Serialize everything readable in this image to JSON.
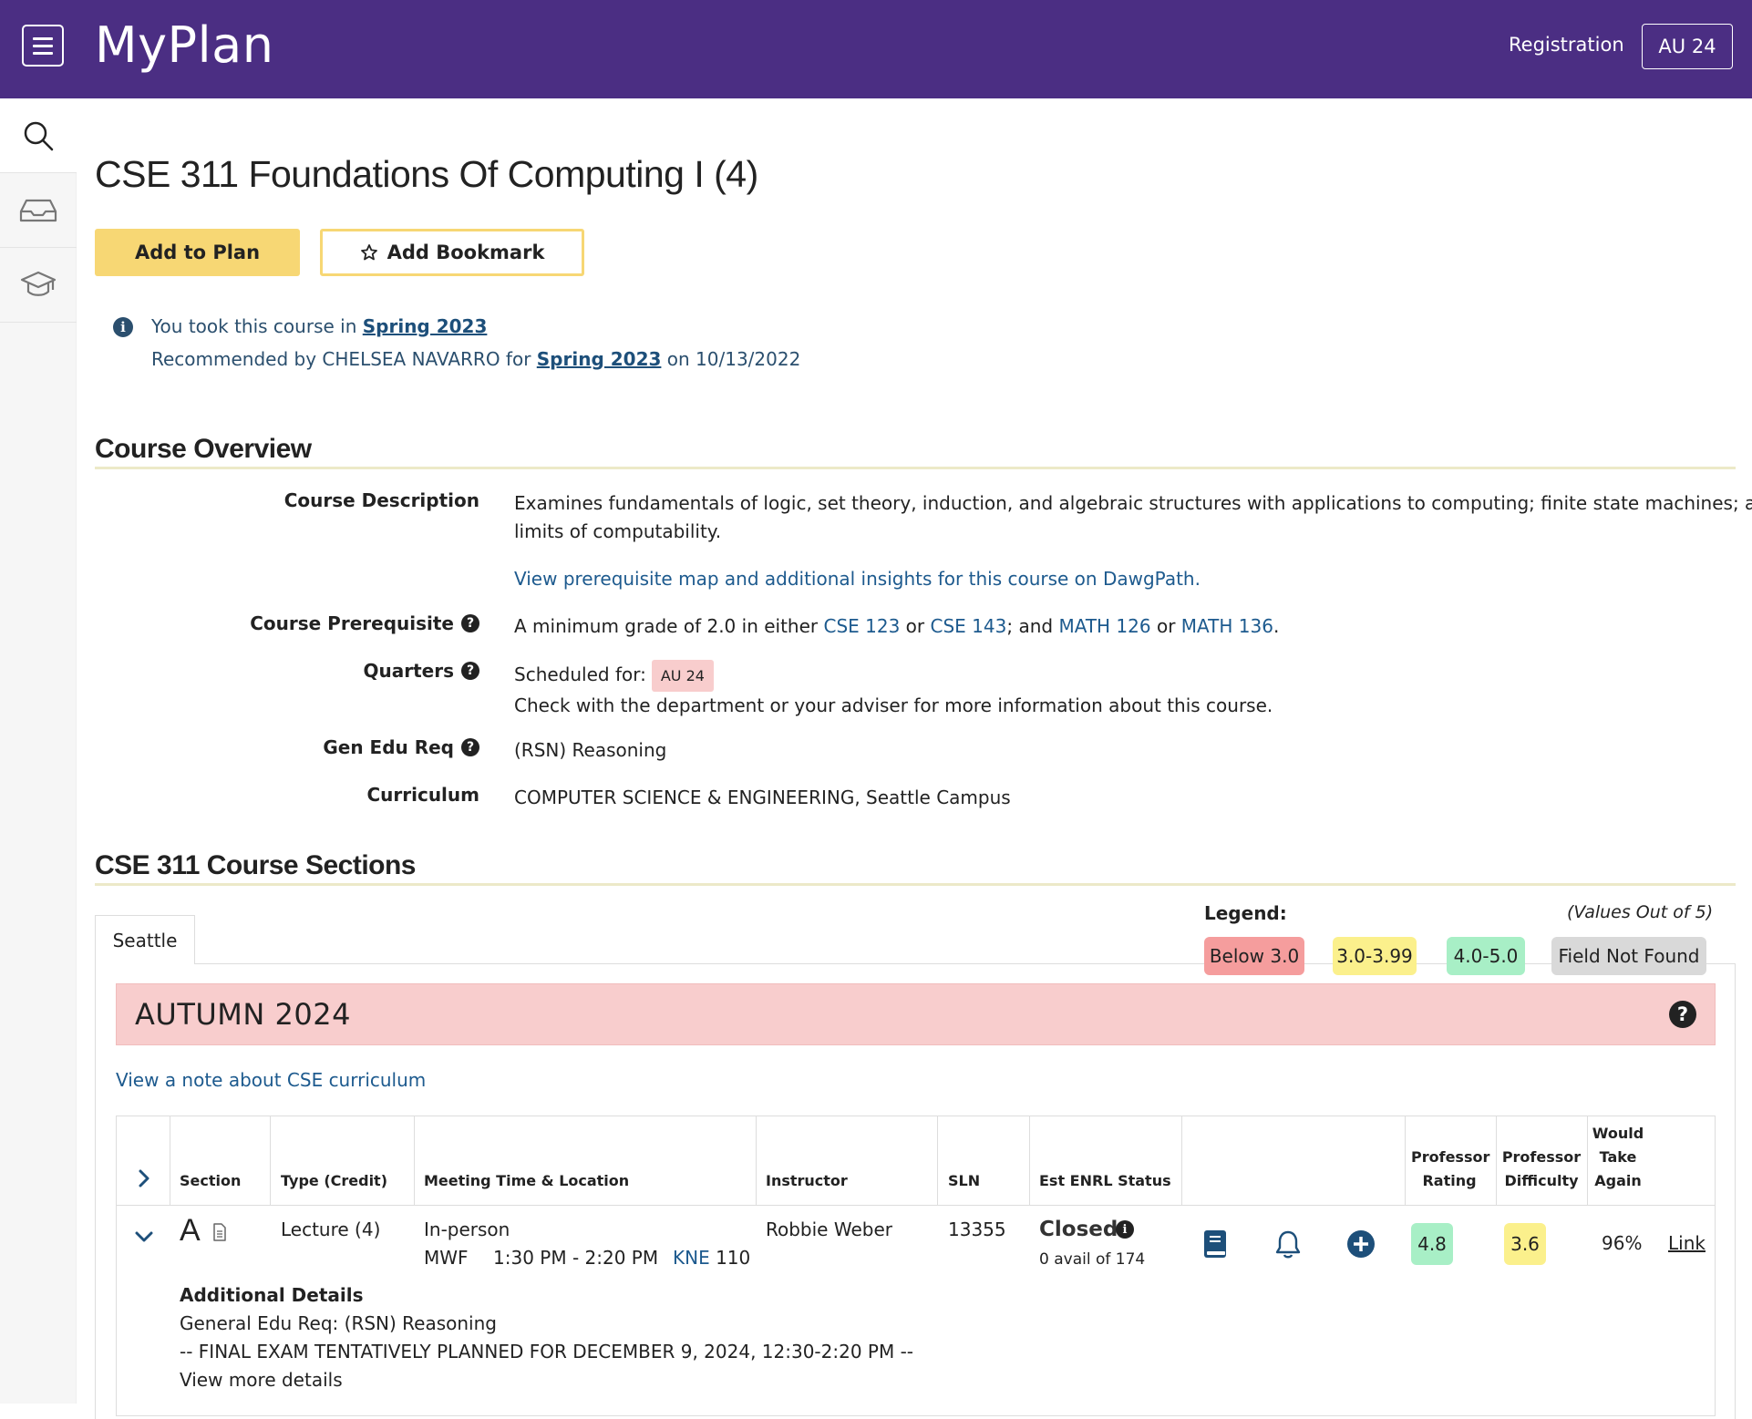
{
  "header": {
    "brand": "MyPlan",
    "registration_label": "Registration",
    "term_button": "AU 24"
  },
  "course": {
    "title": "CSE 311 Foundations Of Computing I (4)",
    "add_to_plan": "Add to Plan",
    "add_bookmark": "Add Bookmark"
  },
  "info": {
    "took_prefix": "You took this course in ",
    "took_term": "Spring 2023",
    "rec_prefix": "Recommended by CHELSEA NAVARRO for ",
    "rec_term": "Spring 2023",
    "rec_suffix": " on 10/13/2022"
  },
  "overview": {
    "heading": "Course Overview",
    "description_label": "Course Description",
    "description_line1": "Examines fundamentals of logic, set theory, induction, and algebraic structures with applications to computing; finite state machines; and",
    "description_line2": "limits of computability.",
    "dawgpath_link": "View prerequisite map and additional insights for this course on DawgPath.",
    "prereq_label": "Course Prerequisite",
    "prereq_text_1": "A minimum grade of 2.0 in either ",
    "prereq_cse123": "CSE 123",
    "prereq_or1": " or ",
    "prereq_cse143": "CSE 143",
    "prereq_and": "; and ",
    "prereq_math126": "MATH 126",
    "prereq_or2": " or ",
    "prereq_math136": "MATH 136",
    "prereq_end": ".",
    "quarters_label": "Quarters",
    "scheduled_for": "Scheduled for:",
    "scheduled_term": "AU 24",
    "check_note": "Check with the department or your adviser for more information about this course.",
    "genedu_label": "Gen Edu Req",
    "genedu_value": "(RSN) Reasoning",
    "curriculum_label": "Curriculum",
    "curriculum_value": "COMPUTER SCIENCE & ENGINEERING, Seattle Campus"
  },
  "sections": {
    "heading": "CSE 311 Course Sections",
    "tab_seattle": "Seattle",
    "legend_title": "Legend:",
    "legend_note": "(Values Out of 5)",
    "legend": [
      {
        "label": "Below 3.0",
        "color": "#f59d9d"
      },
      {
        "label": "3.0-3.99",
        "color": "#fbf08c"
      },
      {
        "label": "4.0-5.0",
        "color": "#a8efc6"
      },
      {
        "label": "Field Not Found",
        "color": "#d9d9d9"
      }
    ],
    "term_name": "AUTUMN 2024",
    "term_help": "?",
    "note_link": "View a note about CSE curriculum"
  },
  "table": {
    "headers": {
      "section": "Section",
      "type": "Type (Credit)",
      "meeting": "Meeting Time & Location",
      "instructor": "Instructor",
      "sln": "SLN",
      "status": "Est ENRL Status",
      "prof_rating_1": "Professor",
      "prof_rating_2": "Rating",
      "prof_diff_1": "Professor",
      "prof_diff_2": "Difficulty",
      "would_1": "Would",
      "would_2": "Take",
      "would_3": "Again"
    },
    "row": {
      "section": "A",
      "type": "Lecture (4)",
      "mode": "In-person",
      "days": "MWF",
      "time": "1:30 PM - 2:20 PM",
      "building": "KNE",
      "room": " 110",
      "instructor": "Robbie Weber",
      "sln": "13355",
      "status": "Closed",
      "avail": "0 avail of 174",
      "prof_rating": "4.8",
      "prof_difficulty": "3.6",
      "would_take_again": "96%",
      "link": "Link",
      "details_title": "Additional Details",
      "details_genedu": "General Edu Req: (RSN) Reasoning",
      "details_final": "-- FINAL EXAM TENTATIVELY PLANNED FOR DECEMBER 9, 2024, 12:30-2:20 PM --",
      "view_more": "View more details"
    }
  },
  "colors": {
    "brand_purple": "#4b2e83",
    "gold": "#f7d774",
    "link_blue": "#1d5a8e",
    "term_pink": "#f8cdcd"
  },
  "icons": [
    "hamburger-icon",
    "search-icon",
    "inbox-icon",
    "graduation-cap-icon",
    "star-icon",
    "info-icon",
    "help-icon",
    "chevron-right-icon",
    "chevron-down-icon",
    "document-icon",
    "book-icon",
    "bell-icon",
    "plus-circle-icon"
  ]
}
